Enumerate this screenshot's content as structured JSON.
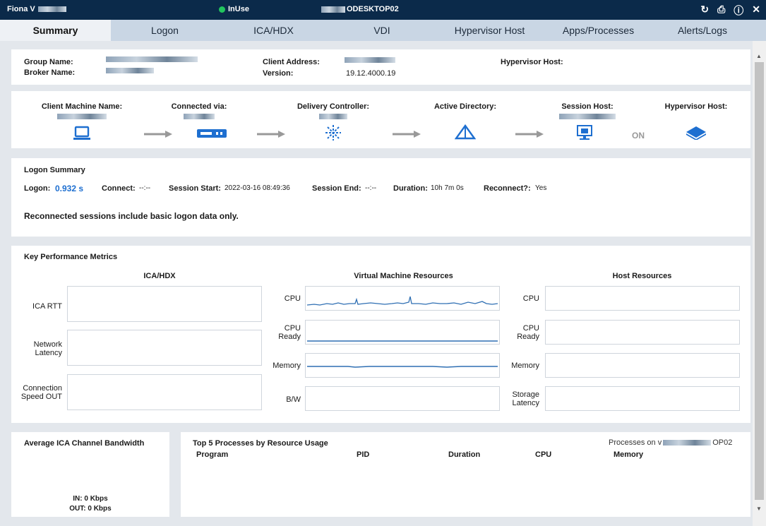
{
  "titlebar": {
    "user": "Fiona V",
    "status": "InUse",
    "machine": "ODESKTOP02",
    "icons": [
      "refresh-icon",
      "print-icon",
      "help-icon",
      "close-icon"
    ]
  },
  "tabs": [
    "Summary",
    "Logon",
    "ICA/HDX",
    "VDI",
    "Hypervisor Host",
    "Apps/Processes",
    "Alerts/Logs"
  ],
  "info": {
    "group_name_label": "Group Name:",
    "broker_name_label": "Broker Name:",
    "client_address_label": "Client Address:",
    "version_label": "Version:",
    "version_value": "19.12.4000.19",
    "hypervisor_host_label": "Hypervisor Host:"
  },
  "chain": {
    "client_machine": "Client Machine Name:",
    "connected_via": "Connected via:",
    "delivery_controller": "Delivery Controller:",
    "active_directory": "Active Directory:",
    "session_host": "Session Host:",
    "hypervisor_host": "Hypervisor Host:",
    "on_label": "ON"
  },
  "logon": {
    "title": "Logon Summary",
    "logon_label": "Logon:",
    "logon_value": "0.932 s",
    "connect_label": "Connect:",
    "connect_value": "--:--",
    "session_start_label": "Session Start:",
    "session_start_value": "2022-03-16 08:49:36",
    "session_end_label": "Session End:",
    "session_end_value": "--:--",
    "duration_label": "Duration:",
    "duration_value": "10h 7m 0s",
    "reconnect_label": "Reconnect?:",
    "reconnect_value": "Yes",
    "note": "Reconnected sessions include basic logon data only."
  },
  "kpm": {
    "title": "Key Performance Metrics",
    "ica_title": "ICA/HDX",
    "vm_title": "Virtual Machine Resources",
    "host_title": "Host Resources",
    "ica_rows": [
      "ICA RTT",
      "Network Latency",
      "Connection Speed OUT"
    ],
    "vm_rows": [
      "CPU",
      "CPU Ready",
      "Memory",
      "B/W"
    ],
    "host_rows": [
      "CPU",
      "CPU Ready",
      "Memory",
      "Storage Latency"
    ],
    "line_color": "#2f6fb3"
  },
  "bandwidth": {
    "title": "Average ICA Channel Bandwidth",
    "in": "IN: 0 Kbps",
    "out": "OUT: 0 Kbps"
  },
  "processes": {
    "title": "Top 5 Processes by Resource Usage",
    "on_label": "Processes on v",
    "on_suffix": "OP02",
    "columns": [
      "Program",
      "PID",
      "Duration",
      "CPU",
      "Memory"
    ]
  },
  "colors": {
    "titlebar": "#0b2a4a",
    "accent": "#1e6fd0",
    "status": "#22c55e"
  }
}
